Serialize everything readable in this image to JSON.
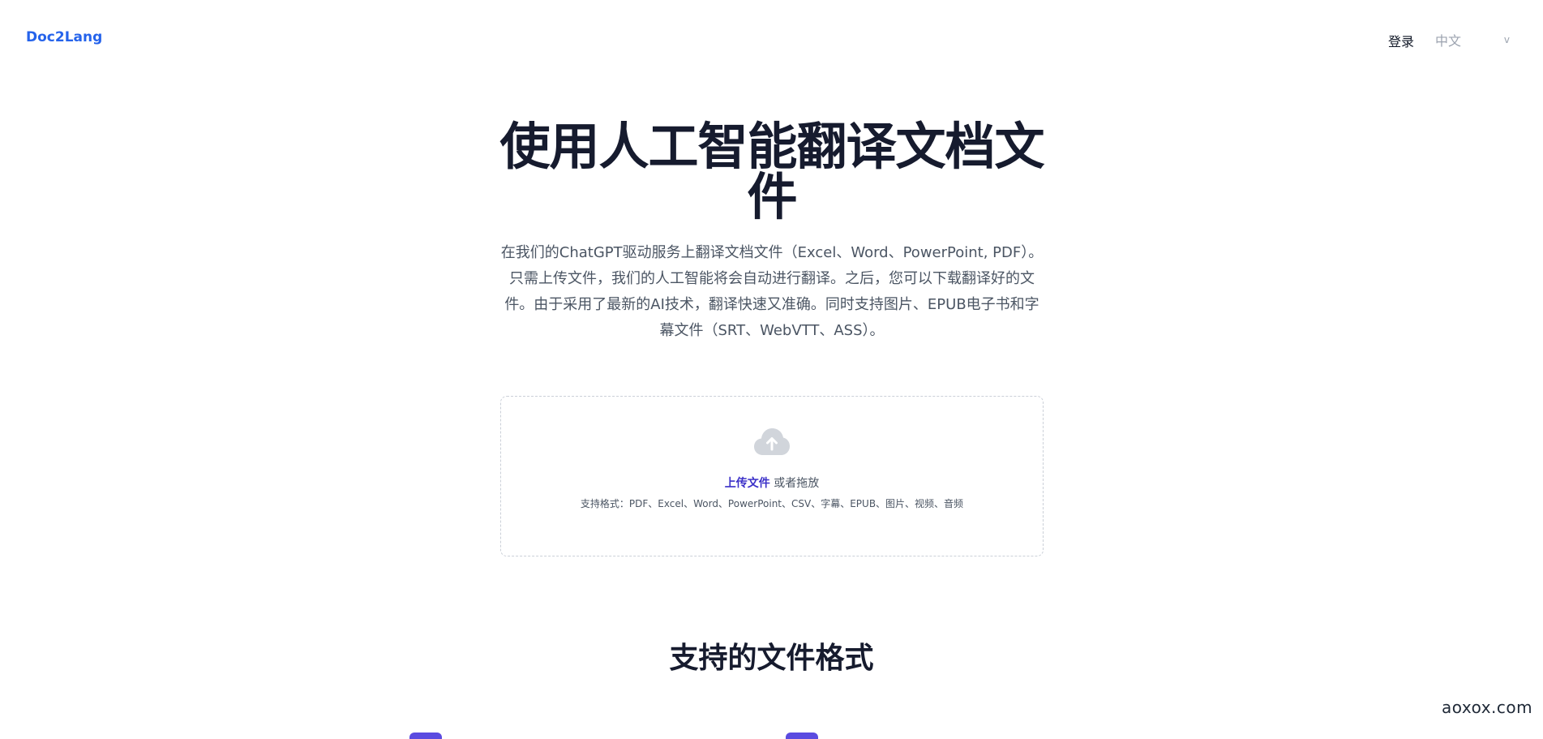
{
  "header": {
    "logo": "Doc2Lang",
    "login": "登录",
    "language": {
      "selected": "中文",
      "chevron": "v"
    }
  },
  "hero": {
    "title": "使用人工智能翻译文档文件",
    "description": "在我们的ChatGPT驱动服务上翻译文档文件（Excel、Word、PowerPoint, PDF）。只需上传文件，我们的人工智能将会自动进行翻译。之后，您可以下载翻译好的文件。由于采用了最新的AI技术，翻译快速又准确。同时支持图片、EPUB电子书和字幕文件（SRT、WebVTT、ASS）。"
  },
  "upload": {
    "icon": "cloud-upload-icon",
    "upload_link": "上传文件",
    "or_drag": " 或者拖放",
    "formats": "支持格式：PDF、Excel、Word、PowerPoint、CSV、字幕、EPUB、图片、视频、音频"
  },
  "formats_section": {
    "title": "支持的文件格式"
  },
  "watermark": "aoxox.com",
  "colors": {
    "brand": "#2563eb",
    "accent": "#3b30c8",
    "feature_icon": "#5b4be0",
    "title": "#161b2e"
  }
}
